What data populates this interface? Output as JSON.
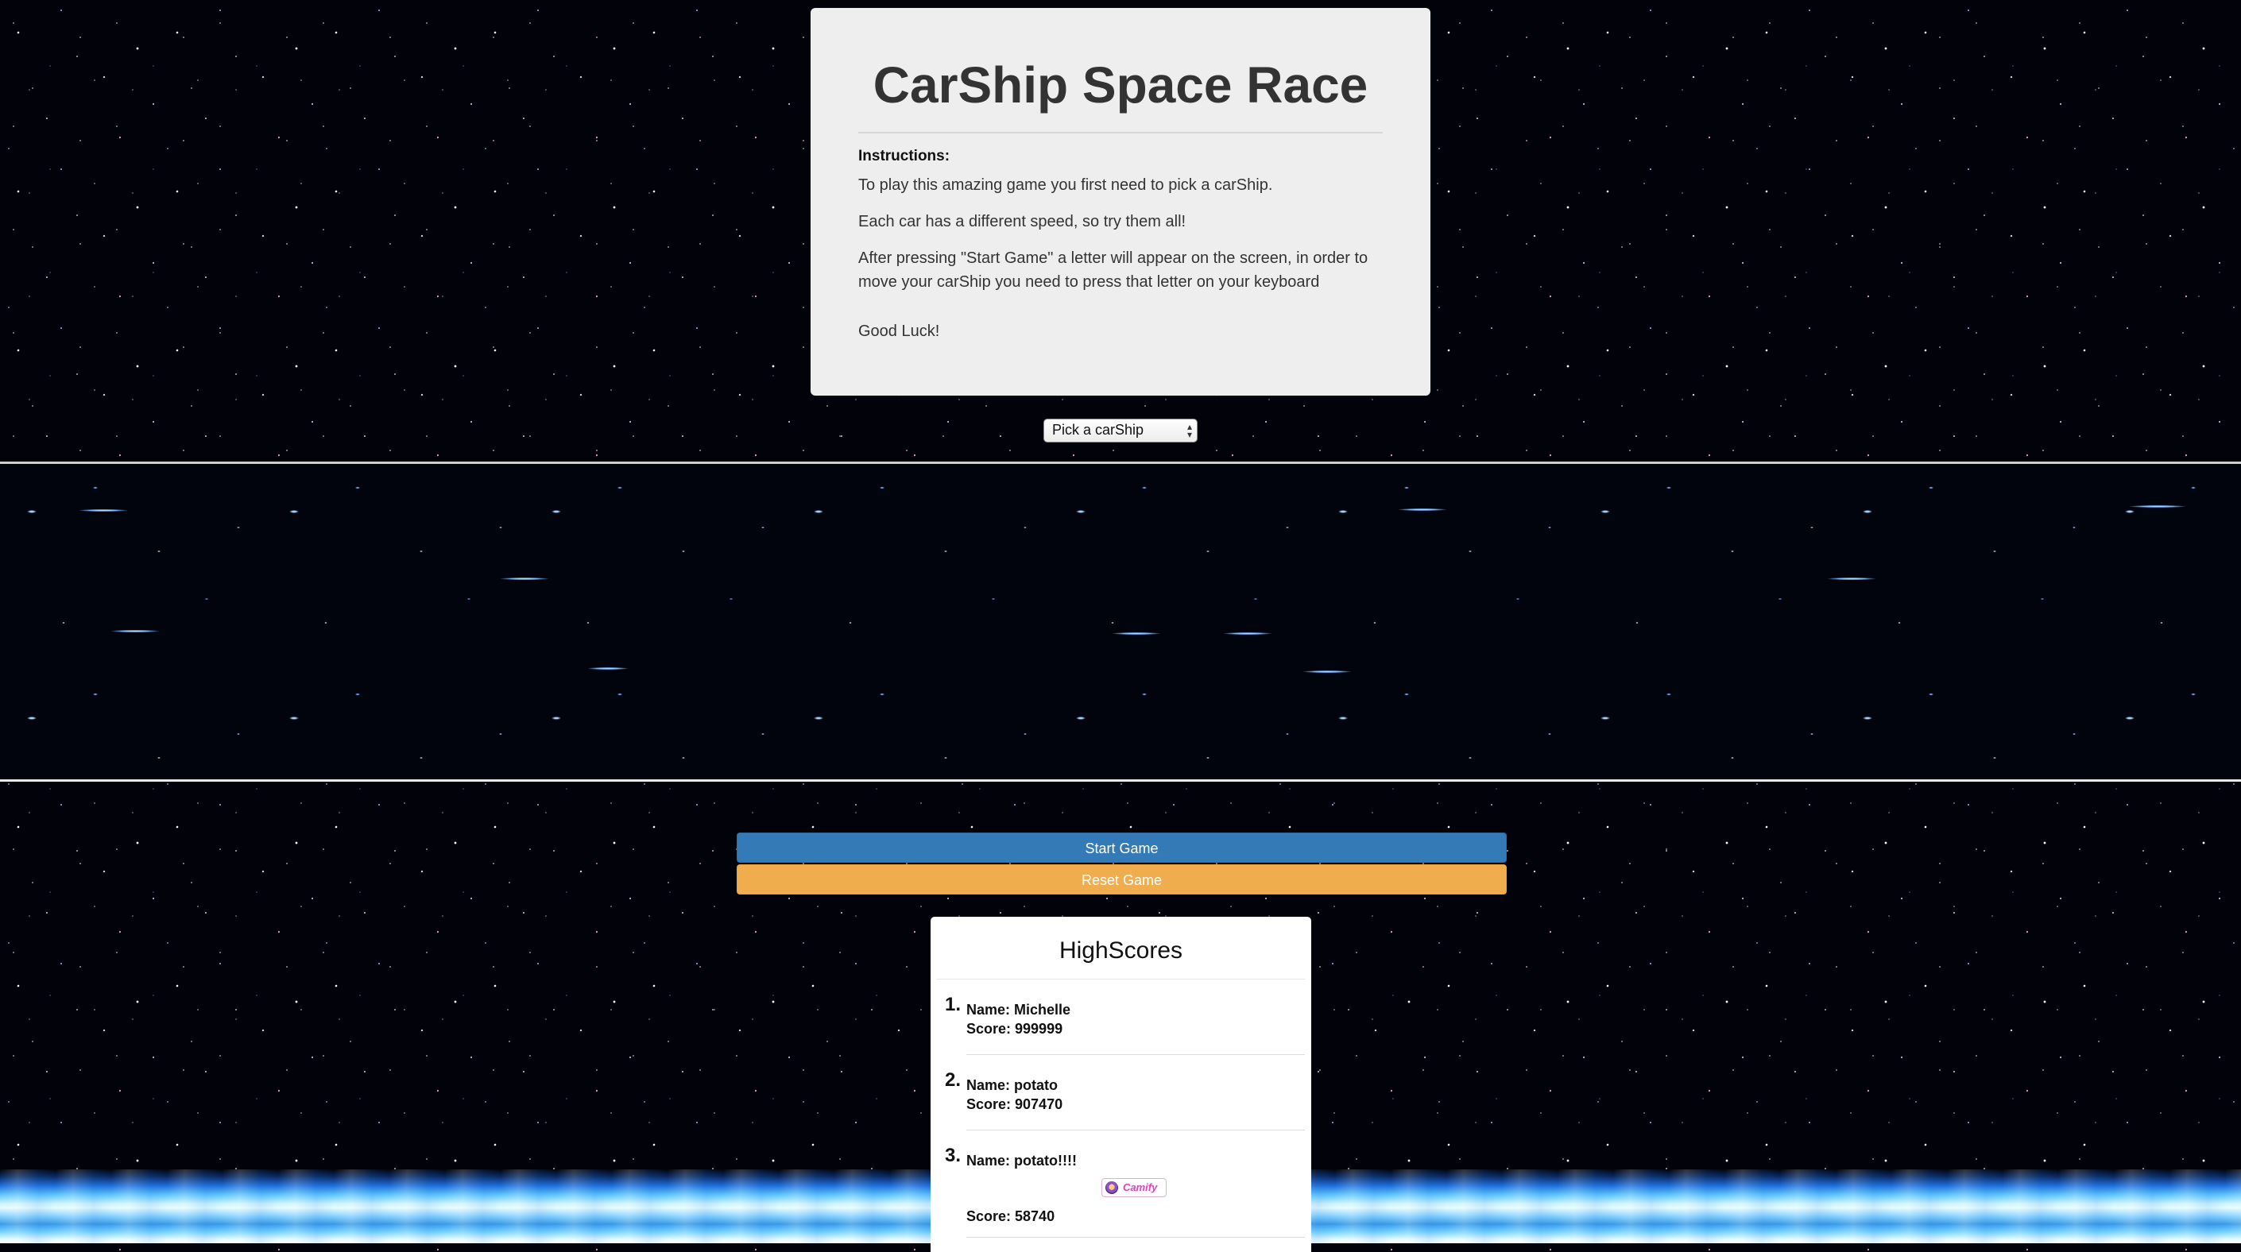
{
  "instructions": {
    "title": "CarShip Space Race",
    "label": "Instructions:",
    "paragraphs": [
      "To play this amazing game you first need to pick a carShip.",
      "Each car has a different speed, so try them all!",
      "After pressing \"Start Game\" a letter will appear on the screen, in order to move your carShip you need to press that letter on your keyboard"
    ],
    "closing": "Good Luck!"
  },
  "ship_select": {
    "selected": "Pick a carShip"
  },
  "buttons": {
    "start_label": "Start Game",
    "reset_label": "Reset Game"
  },
  "highscores": {
    "title": "HighScores",
    "entries": [
      {
        "rank": "1.",
        "name": "Name: Michelle",
        "score": "Score: 999999"
      },
      {
        "rank": "2.",
        "name": "Name: potato",
        "score": "Score: 907470"
      },
      {
        "rank": "3.",
        "name": "Name: potato!!!!",
        "score": "Score: 58740",
        "badge": "Camify"
      }
    ]
  },
  "colors": {
    "start_button": "#337ab7",
    "reset_button": "#f0ad4e",
    "panel_bg": "#eeeeee"
  },
  "icons": {
    "badge_icon": "camify-avatar-icon",
    "select_arrows": "up-down-arrows-icon"
  }
}
